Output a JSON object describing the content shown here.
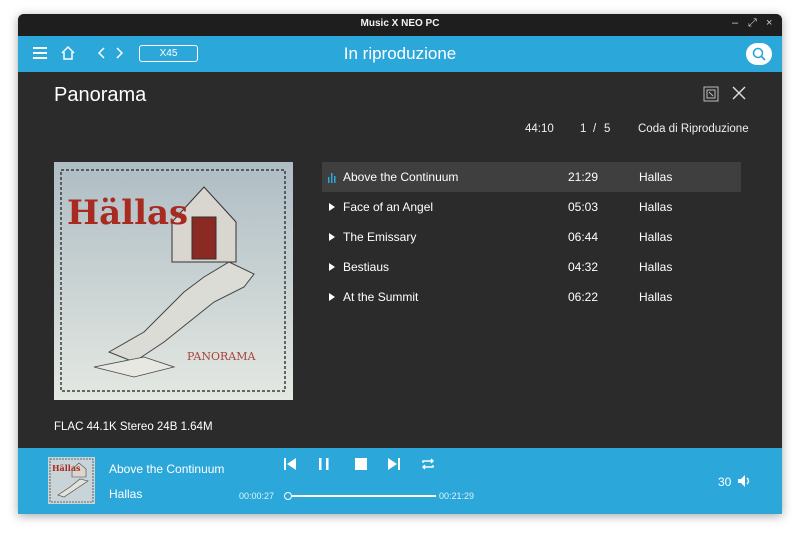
{
  "window": {
    "title": "Music X NEO PC"
  },
  "toolbar": {
    "badge_label": "X45",
    "heading": "In riproduzione"
  },
  "album": {
    "title": "Panorama",
    "total_time": "44:10",
    "position": "1",
    "separator": "/",
    "count": "5",
    "queue_label": "Coda di Riproduzione",
    "format": "FLAC 44.1K Stereo 24B 1.64M",
    "cover_band_text": "Hällas",
    "cover_album_text": "PANORAMA"
  },
  "tracks": [
    {
      "name": "Above the Continuum",
      "duration": "21:29",
      "artist": "Hallas",
      "active": true
    },
    {
      "name": "Face of an Angel",
      "duration": "05:03",
      "artist": "Hallas",
      "active": false
    },
    {
      "name": "The Emissary",
      "duration": "06:44",
      "artist": "Hallas",
      "active": false
    },
    {
      "name": "Bestiaus",
      "duration": "04:32",
      "artist": "Hallas",
      "active": false
    },
    {
      "name": "At the Summit",
      "duration": "06:22",
      "artist": "Hallas",
      "active": false
    }
  ],
  "player": {
    "title": "Above the Continuum",
    "artist": "Hallas",
    "elapsed": "00:00:27",
    "total": "00:21:29",
    "progress_fraction": 0.02,
    "volume": "30"
  },
  "colors": {
    "accent": "#2ca7d9",
    "background": "#2b2b2b",
    "titlebar": "#1e1e1e",
    "active_row": "#3f3f3f"
  }
}
